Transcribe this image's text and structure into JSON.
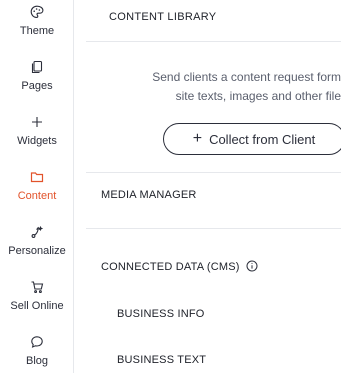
{
  "sidebar": {
    "items": [
      {
        "label": "Theme",
        "icon": "palette-icon",
        "active": false
      },
      {
        "label": "Pages",
        "icon": "pages-icon",
        "active": false
      },
      {
        "label": "Widgets",
        "icon": "plus-icon",
        "active": false
      },
      {
        "label": "Content",
        "icon": "folder-icon",
        "active": true
      },
      {
        "label": "Personalize",
        "icon": "personalize-icon",
        "active": false
      },
      {
        "label": "Sell Online",
        "icon": "cart-icon",
        "active": false
      },
      {
        "label": "Blog",
        "icon": "speech-bubble-icon",
        "active": false
      }
    ],
    "active_color": "#e2532b"
  },
  "panel": {
    "title": "CONTENT LIBRARY",
    "description_line1": "Send clients a content request form",
    "description_line2": "site texts, images and other file",
    "collect_button_plus": "+",
    "collect_button_label": "Collect from Client",
    "media_manager": "MEDIA MANAGER",
    "connected_data": "CONNECTED DATA (CMS)",
    "business_info": "BUSINESS INFO",
    "business_text": "BUSINESS TEXT"
  }
}
